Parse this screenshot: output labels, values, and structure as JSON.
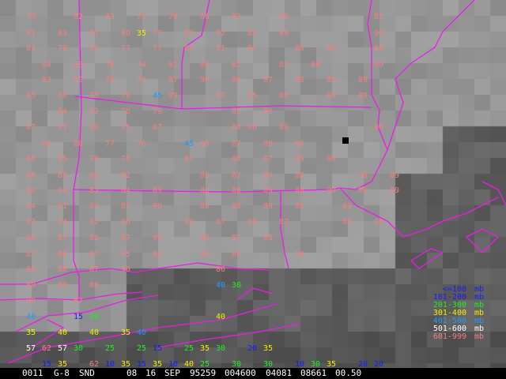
{
  "colors": {
    "borders": "#e81ee8",
    "marker": "#000000",
    "footer_bg": "#000000",
    "footer_text": "#ffffff"
  },
  "legend": [
    {
      "range": "<=100",
      "unit": "mb",
      "color": "#1a1aff"
    },
    {
      "range": "101-200",
      "unit": "mb",
      "color": "#1a1aff"
    },
    {
      "range": "201-300",
      "unit": "mb",
      "color": "#22ee22"
    },
    {
      "range": "301-400",
      "unit": "mb",
      "color": "#f0f000"
    },
    {
      "range": "401-500",
      "unit": "mb",
      "color": "#2299ff"
    },
    {
      "range": "501-600",
      "unit": "mb",
      "color": "#ffffff"
    },
    {
      "range": "601-999",
      "unit": "mb",
      "color": "#f08080"
    }
  ],
  "footer": {
    "fields": [
      "0011",
      "G-8",
      "SND",
      "08",
      "16",
      "SEP",
      "95259",
      "004600",
      "04081",
      "08661",
      "00.50"
    ]
  },
  "observations": [
    {
      "v": "79",
      "c": "p"
    },
    {
      "v": "82",
      "c": "p"
    },
    {
      "v": "83",
      "c": "p"
    },
    {
      "v": "75",
      "c": "p"
    },
    {
      "v": "79",
      "c": "p"
    },
    {
      "v": "86",
      "c": "p"
    },
    {
      "v": "83",
      "c": "p"
    },
    {
      "v": "90",
      "c": "p"
    },
    {
      "v": "82",
      "c": "p"
    },
    {
      "v": "81",
      "c": "p"
    },
    {
      "v": "83",
      "c": "p"
    },
    {
      "v": "81",
      "c": "p"
    },
    {
      "v": "80",
      "c": "p"
    },
    {
      "v": "35",
      "c": "y"
    },
    {
      "v": "77",
      "c": "p"
    },
    {
      "v": "82",
      "c": "p"
    },
    {
      "v": "82",
      "c": "p"
    },
    {
      "v": "81",
      "c": "p"
    },
    {
      "v": "89",
      "c": "p"
    },
    {
      "v": "90",
      "c": "p"
    },
    {
      "v": "83",
      "c": "p"
    },
    {
      "v": "79",
      "c": "p"
    },
    {
      "v": "81",
      "c": "p"
    },
    {
      "v": "77",
      "c": "p"
    },
    {
      "v": "77",
      "c": "p"
    },
    {
      "v": "85",
      "c": "p"
    },
    {
      "v": "81",
      "c": "p"
    },
    {
      "v": "87",
      "c": "p"
    },
    {
      "v": "89",
      "c": "p"
    },
    {
      "v": "88",
      "c": "p"
    },
    {
      "v": "89",
      "c": "p"
    },
    {
      "v": "84",
      "c": "p"
    },
    {
      "v": "83",
      "c": "p"
    },
    {
      "v": "78",
      "c": "p"
    },
    {
      "v": "74",
      "c": "p"
    },
    {
      "v": "81",
      "c": "p"
    },
    {
      "v": "84",
      "c": "p"
    },
    {
      "v": "82",
      "c": "p"
    },
    {
      "v": "87",
      "c": "p"
    },
    {
      "v": "88",
      "c": "p"
    },
    {
      "v": "89",
      "c": "p"
    },
    {
      "v": "83",
      "c": "p"
    },
    {
      "v": "82",
      "c": "p"
    },
    {
      "v": "75",
      "c": "p"
    },
    {
      "v": "74",
      "c": "p"
    },
    {
      "v": "87",
      "c": "p"
    },
    {
      "v": "90",
      "c": "p"
    },
    {
      "v": "86",
      "c": "p"
    },
    {
      "v": "87",
      "c": "p"
    },
    {
      "v": "89",
      "c": "p"
    },
    {
      "v": "89",
      "c": "p"
    },
    {
      "v": "89",
      "c": "p"
    },
    {
      "v": "85",
      "c": "p"
    },
    {
      "v": "80",
      "c": "p"
    },
    {
      "v": "79",
      "c": "p"
    },
    {
      "v": "70",
      "c": "p"
    },
    {
      "v": "45",
      "c": "c"
    },
    {
      "v": "89",
      "c": "p"
    },
    {
      "v": "87",
      "c": "p"
    },
    {
      "v": "85",
      "c": "p"
    },
    {
      "v": "88",
      "c": "p"
    },
    {
      "v": "89",
      "c": "p"
    },
    {
      "v": "89",
      "c": "p"
    },
    {
      "v": "84",
      "c": "p"
    },
    {
      "v": "82",
      "c": "p"
    },
    {
      "v": "76",
      "c": "p"
    },
    {
      "v": "79",
      "c": "p"
    },
    {
      "v": "85",
      "c": "p"
    },
    {
      "v": "88",
      "c": "p"
    },
    {
      "v": "87",
      "c": "p"
    },
    {
      "v": "81",
      "c": "p"
    },
    {
      "v": "80",
      "c": "p"
    },
    {
      "v": "75",
      "c": "p"
    },
    {
      "v": "87",
      "c": "p"
    },
    {
      "v": "88",
      "c": "p"
    },
    {
      "v": "86",
      "c": "p"
    },
    {
      "v": "89",
      "c": "p"
    },
    {
      "v": "90",
      "c": "p"
    },
    {
      "v": "88",
      "c": "p"
    },
    {
      "v": "80",
      "c": "p"
    },
    {
      "v": "77",
      "c": "p"
    },
    {
      "v": "76",
      "c": "p"
    },
    {
      "v": "45",
      "c": "c"
    },
    {
      "v": "90",
      "c": "p"
    },
    {
      "v": "87",
      "c": "p"
    },
    {
      "v": "89",
      "c": "p"
    },
    {
      "v": "90",
      "c": "p"
    },
    {
      "v": "88",
      "c": "p"
    },
    {
      "v": "85",
      "c": "p"
    },
    {
      "v": "79",
      "c": "p"
    },
    {
      "v": "76",
      "c": "p"
    },
    {
      "v": "87",
      "c": "p"
    },
    {
      "v": "86",
      "c": "p"
    },
    {
      "v": "87",
      "c": "p"
    },
    {
      "v": "89",
      "c": "p"
    },
    {
      "v": "90",
      "c": "p"
    },
    {
      "v": "88",
      "c": "p"
    },
    {
      "v": "85",
      "c": "p"
    },
    {
      "v": "82",
      "c": "p"
    },
    {
      "v": "82",
      "c": "p"
    },
    {
      "v": "89",
      "c": "p"
    },
    {
      "v": "87",
      "c": "p"
    },
    {
      "v": "89",
      "c": "p"
    },
    {
      "v": "89",
      "c": "p"
    },
    {
      "v": "90",
      "c": "p"
    },
    {
      "v": "89",
      "c": "p"
    },
    {
      "v": "84",
      "c": "p"
    },
    {
      "v": "84",
      "c": "p"
    },
    {
      "v": "82",
      "c": "p"
    },
    {
      "v": "84",
      "c": "p"
    },
    {
      "v": "89",
      "c": "p"
    },
    {
      "v": "88",
      "c": "p"
    },
    {
      "v": "88",
      "c": "p"
    },
    {
      "v": "89",
      "c": "p"
    },
    {
      "v": "88",
      "c": "p"
    },
    {
      "v": "90",
      "c": "p"
    },
    {
      "v": "89",
      "c": "p"
    },
    {
      "v": "89",
      "c": "p"
    },
    {
      "v": "84",
      "c": "p"
    },
    {
      "v": "81",
      "c": "p"
    },
    {
      "v": "83",
      "c": "p"
    },
    {
      "v": "87",
      "c": "p"
    },
    {
      "v": "90",
      "c": "p"
    },
    {
      "v": "88",
      "c": "p"
    },
    {
      "v": "88",
      "c": "p"
    },
    {
      "v": "89",
      "c": "p"
    },
    {
      "v": "89",
      "c": "p"
    },
    {
      "v": "89",
      "c": "p"
    },
    {
      "v": "83",
      "c": "p"
    },
    {
      "v": "84",
      "c": "p"
    },
    {
      "v": "82",
      "c": "p"
    },
    {
      "v": "86",
      "c": "p"
    },
    {
      "v": "90",
      "c": "p"
    },
    {
      "v": "87",
      "c": "p"
    },
    {
      "v": "88",
      "c": "p"
    },
    {
      "v": "87",
      "c": "p"
    },
    {
      "v": "89",
      "c": "p"
    },
    {
      "v": "90",
      "c": "p"
    },
    {
      "v": "86",
      "c": "p"
    },
    {
      "v": "87",
      "c": "p"
    },
    {
      "v": "86",
      "c": "p"
    },
    {
      "v": "87",
      "c": "p"
    },
    {
      "v": "90",
      "c": "p"
    },
    {
      "v": "88",
      "c": "p"
    },
    {
      "v": "87",
      "c": "p"
    },
    {
      "v": "89",
      "c": "p"
    },
    {
      "v": "87",
      "c": "p"
    },
    {
      "v": "86",
      "c": "p"
    },
    {
      "v": "87",
      "c": "p"
    },
    {
      "v": "85",
      "c": "p"
    },
    {
      "v": "89",
      "c": "p"
    },
    {
      "v": "89",
      "c": "p"
    },
    {
      "v": "89",
      "c": "p"
    },
    {
      "v": "90",
      "c": "p"
    },
    {
      "v": "88",
      "c": "p"
    },
    {
      "v": "88",
      "c": "p"
    },
    {
      "v": "87",
      "c": "p"
    },
    {
      "v": "90",
      "c": "p"
    },
    {
      "v": "86",
      "c": "p"
    },
    {
      "v": "89",
      "c": "p"
    },
    {
      "v": "88",
      "c": "p"
    },
    {
      "v": "86",
      "c": "p"
    },
    {
      "v": "40",
      "c": "c"
    },
    {
      "v": "30",
      "c": "g"
    },
    {
      "v": "89",
      "c": "p"
    },
    {
      "v": "67",
      "c": "p"
    },
    {
      "v": "40",
      "c": "c"
    },
    {
      "v": "15",
      "c": "b"
    },
    {
      "v": "30",
      "c": "g"
    },
    {
      "v": "40",
      "c": "y"
    },
    {
      "v": "35",
      "c": "y"
    },
    {
      "v": "40",
      "c": "y"
    },
    {
      "v": "40",
      "c": "y"
    },
    {
      "v": "35",
      "c": "y"
    },
    {
      "v": "40",
      "c": "c"
    },
    {
      "v": "57",
      "c": "w"
    },
    {
      "v": "62",
      "c": "p"
    },
    {
      "v": "57",
      "c": "w"
    },
    {
      "v": "30",
      "c": "g"
    },
    {
      "v": "25",
      "c": "g"
    },
    {
      "v": "25",
      "c": "g"
    },
    {
      "v": "15",
      "c": "b"
    },
    {
      "v": "25",
      "c": "g"
    },
    {
      "v": "35",
      "c": "y"
    },
    {
      "v": "30",
      "c": "g"
    },
    {
      "v": "20",
      "c": "b"
    },
    {
      "v": "35",
      "c": "y"
    },
    {
      "v": "15",
      "c": "b"
    },
    {
      "v": "35",
      "c": "y"
    },
    {
      "v": "62",
      "c": "p"
    },
    {
      "v": "10",
      "c": "b"
    },
    {
      "v": "35",
      "c": "y"
    },
    {
      "v": "15",
      "c": "b"
    },
    {
      "v": "35",
      "c": "y"
    },
    {
      "v": "10",
      "c": "b"
    },
    {
      "v": "40",
      "c": "y"
    },
    {
      "v": "25",
      "c": "g"
    },
    {
      "v": "30",
      "c": "g"
    },
    {
      "v": "30",
      "c": "g"
    },
    {
      "v": "10",
      "c": "b"
    },
    {
      "v": "30",
      "c": "g"
    },
    {
      "v": "35",
      "c": "y"
    },
    {
      "v": "20",
      "c": "b"
    },
    {
      "v": "20",
      "c": "b"
    }
  ]
}
